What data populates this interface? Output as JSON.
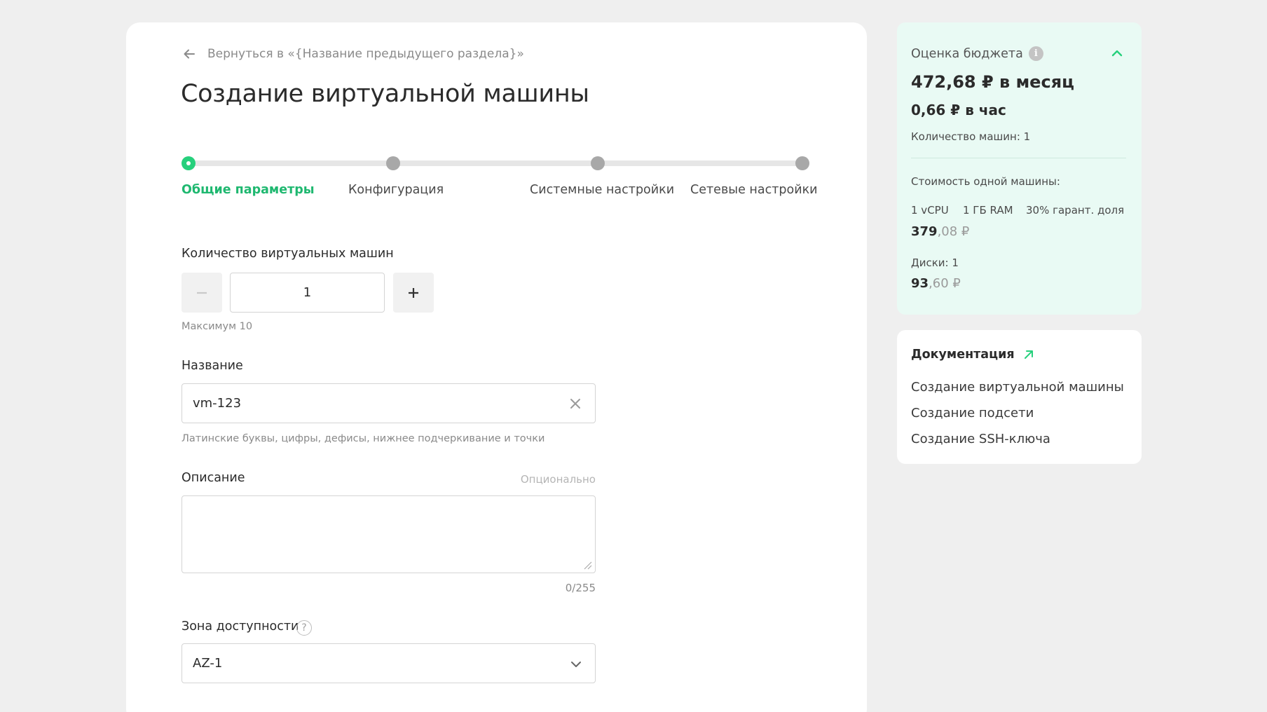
{
  "back_link": "Вернуться в «{Название предыдущего раздела}»",
  "title": "Создание виртуальной машины",
  "steps": [
    {
      "label": "Общие параметры",
      "active": true
    },
    {
      "label": "Конфигурация",
      "active": false
    },
    {
      "label": "Системные настройки",
      "active": false
    },
    {
      "label": "Сетевые настройки",
      "active": false
    }
  ],
  "quantity": {
    "label": "Количество виртуальных машин",
    "value": "1",
    "hint": "Максимум 10",
    "minus_icon": "minus-icon",
    "plus_icon": "plus-icon"
  },
  "name": {
    "label": "Название",
    "value": "vm-123",
    "hint": "Латинские буквы, цифры, дефисы, нижнее подчеркивание и точки"
  },
  "description": {
    "label": "Описание",
    "optional": "Опционально",
    "value": "",
    "counter": "0/255"
  },
  "zone": {
    "label": "Зона доступности",
    "help": "?",
    "value": "AZ-1"
  },
  "budget": {
    "title": "Оценка бюджета",
    "info": "i",
    "per_month": "472,68 ₽ в месяц",
    "per_hour": "0,66 ₽ в час",
    "machines": "Количество машин: 1",
    "one_machine_label": "Стоимость одной машины:",
    "specs": [
      "1 vCPU",
      "1 ГБ RAM",
      "30% гарант. доля"
    ],
    "compute_cost_int": "379",
    "compute_cost_frac": ",08 ₽",
    "disks_label": "Диски: 1",
    "disks_cost_int": "93",
    "disks_cost_frac": ",60 ₽"
  },
  "docs": {
    "title": "Документация",
    "links": [
      "Создание виртуальной машины",
      "Создание подсети",
      "Создание SSH-ключа"
    ]
  },
  "colors": {
    "accent": "#26d07c",
    "budget_bg": "#e9faf4"
  }
}
